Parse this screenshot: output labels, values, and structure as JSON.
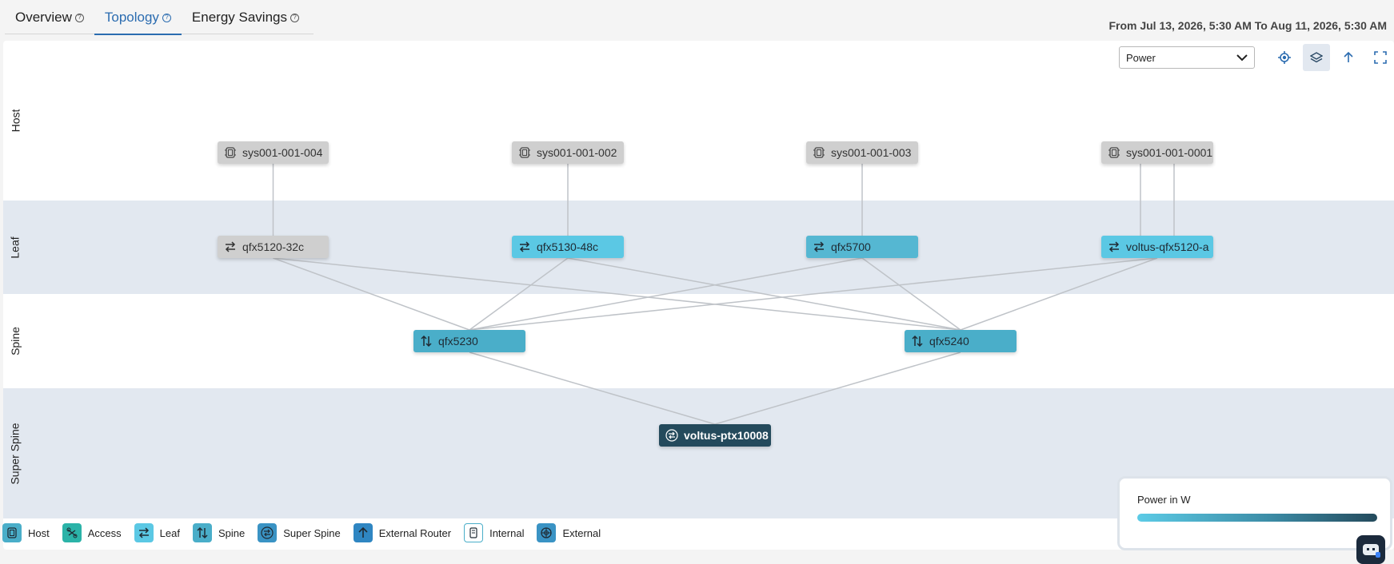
{
  "tabs": [
    {
      "label": "Overview",
      "active": false
    },
    {
      "label": "Topology",
      "active": true
    },
    {
      "label": "Energy Savings",
      "active": false
    }
  ],
  "help_glyph": "?",
  "date_range": "From Jul 13, 2026, 5:30 AM To Aug 11, 2026, 5:30 AM",
  "toolbar": {
    "metric_select_value": "Power",
    "icons": [
      "locate-icon",
      "layers-icon",
      "arrow-up-icon",
      "fullscreen-icon"
    ]
  },
  "layers": [
    {
      "label": "Host"
    },
    {
      "label": "Leaf"
    },
    {
      "label": "Spine"
    },
    {
      "label": "Super Spine"
    }
  ],
  "nodes": {
    "host_1": {
      "label": "sys001-001-004",
      "layer": "Host"
    },
    "host_2": {
      "label": "sys001-001-002",
      "layer": "Host"
    },
    "host_3": {
      "label": "sys001-001-003",
      "layer": "Host"
    },
    "host_4": {
      "label": "sys001-001-0001",
      "layer": "Host"
    },
    "leaf_1": {
      "label": "qfx5120-32c",
      "layer": "Leaf"
    },
    "leaf_2": {
      "label": "qfx5130-48c",
      "layer": "Leaf"
    },
    "leaf_3": {
      "label": "qfx5700",
      "layer": "Leaf"
    },
    "leaf_4": {
      "label": "voltus-qfx5120-a",
      "layer": "Leaf"
    },
    "spine_1": {
      "label": "qfx5230",
      "layer": "Spine"
    },
    "spine_2": {
      "label": "qfx5240",
      "layer": "Spine"
    },
    "superspine_1": {
      "label": "voltus-ptx10008",
      "layer": "Super Spine"
    }
  },
  "links": [
    [
      "host_1",
      "leaf_1"
    ],
    [
      "host_2",
      "leaf_2"
    ],
    [
      "host_3",
      "leaf_3"
    ],
    [
      "host_4",
      "leaf_4"
    ],
    [
      "host_4",
      "leaf_4"
    ],
    [
      "leaf_1",
      "spine_1"
    ],
    [
      "leaf_1",
      "spine_2"
    ],
    [
      "leaf_2",
      "spine_1"
    ],
    [
      "leaf_2",
      "spine_2"
    ],
    [
      "leaf_3",
      "spine_1"
    ],
    [
      "leaf_3",
      "spine_2"
    ],
    [
      "leaf_4",
      "spine_1"
    ],
    [
      "leaf_4",
      "spine_2"
    ],
    [
      "spine_1",
      "superspine_1"
    ],
    [
      "spine_2",
      "superspine_1"
    ]
  ],
  "legend": [
    {
      "label": "Host",
      "icon": "host-icon"
    },
    {
      "label": "Access",
      "icon": "access-icon"
    },
    {
      "label": "Leaf",
      "icon": "leaf-icon"
    },
    {
      "label": "Spine",
      "icon": "spine-icon"
    },
    {
      "label": "Super Spine",
      "icon": "super-spine-icon"
    },
    {
      "label": "External Router",
      "icon": "external-router-icon"
    },
    {
      "label": "Internal",
      "icon": "internal-icon"
    },
    {
      "label": "External",
      "icon": "external-icon"
    }
  ],
  "power_scale": {
    "title": "Power in W",
    "colors": [
      "#5ccbe6",
      "#244a5c"
    ]
  },
  "colors": {
    "accent": "#2b6cb0",
    "band_alt": "#e2e8f0"
  }
}
